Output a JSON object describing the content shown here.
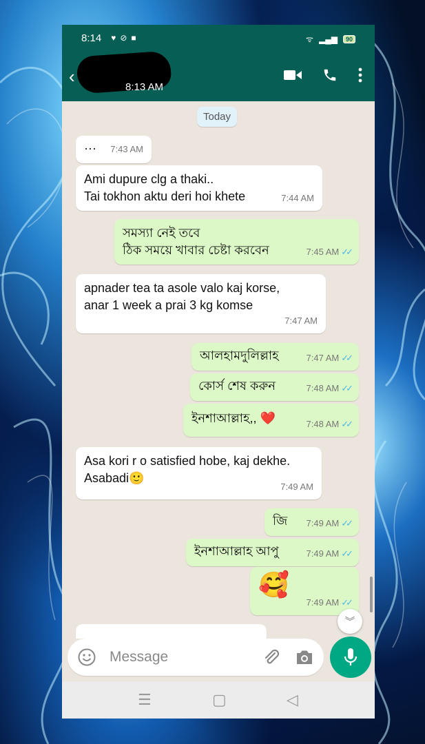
{
  "status_bar": {
    "time": "8:14",
    "battery": "90"
  },
  "header": {
    "last_seen": "8:13 AM"
  },
  "chat": {
    "date_chip": "Today",
    "messages": [
      {
        "dir": "in",
        "text": "···",
        "time": "7:43 AM"
      },
      {
        "dir": "in",
        "text": "Ami dupure clg a thaki..\nTai tokhon aktu deri hoi khete",
        "time": "7:44 AM"
      },
      {
        "dir": "out",
        "text": "সমস্যা নেই তবে\nঠিক সময়ে খাবার চেষ্টা করবেন",
        "time": "7:45 AM"
      },
      {
        "dir": "in",
        "text": "apnader tea ta asole valo kaj korse,\nanar 1 week a prai 3 kg komse",
        "time": "7:47 AM"
      },
      {
        "dir": "out",
        "text": "আলহামদুলিল্লাহ",
        "time": "7:47 AM"
      },
      {
        "dir": "out",
        "text": "কোর্স শেষ করুন",
        "time": "7:48 AM"
      },
      {
        "dir": "out",
        "text": "ইনশাআল্লাহ,, ❤️",
        "time": "7:48 AM"
      },
      {
        "dir": "in",
        "text": "Asa kori r o satisfied hobe, kaj dekhe.\nAsabadi🙂",
        "time": "7:49 AM"
      },
      {
        "dir": "out",
        "text": "জি",
        "time": "7:49 AM"
      },
      {
        "dir": "out",
        "text": "ইনশাআল্লাহ আপু",
        "time": "7:49 AM"
      },
      {
        "dir": "out",
        "text": "🥰",
        "time": "7:49 AM"
      }
    ]
  },
  "input": {
    "placeholder": "Message"
  },
  "colors": {
    "header": "#075e54",
    "outgoing": "#dcf8c6",
    "incoming": "#ffffff",
    "chat_bg": "#ece5dd",
    "mic": "#00a884",
    "tick": "#4fb6ec"
  }
}
